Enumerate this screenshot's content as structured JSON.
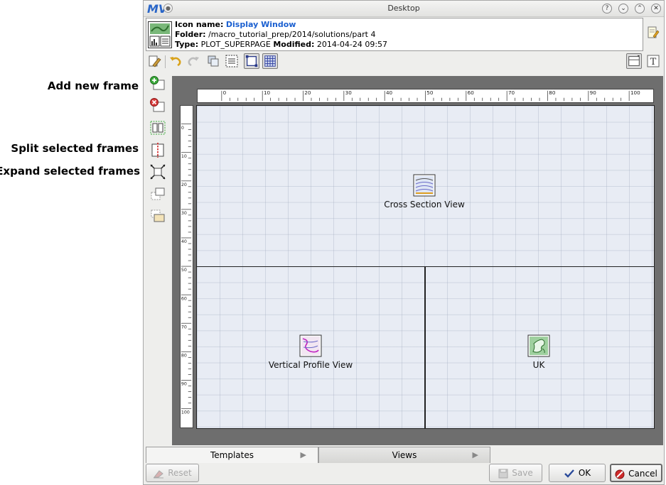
{
  "callouts": {
    "add_new_frame": "Add new frame",
    "split_selected_frames": "Split selected frames",
    "expand_selected_frames": "Expand selected frames"
  },
  "window": {
    "logo": "MV",
    "title": "Desktop",
    "controls": [
      "?",
      "⌄",
      "⌃",
      "✕"
    ]
  },
  "info": {
    "icon_name_label": "Icon name:",
    "icon_name_value": "Display Window",
    "folder_label": "Folder:",
    "folder_value": "/macro_tutorial_prep/2014/solutions/part 4",
    "type_label": "Type:",
    "type_value": "PLOT_SUPERPAGE",
    "modified_label": "Modified:",
    "modified_value": "2014-04-24 09:57"
  },
  "ruler": {
    "h_labels": [
      "0",
      "10",
      "20",
      "30",
      "40",
      "50",
      "60",
      "70",
      "80",
      "90",
      "100"
    ],
    "v_labels": [
      "0",
      "10",
      "20",
      "30",
      "40",
      "50",
      "60",
      "70",
      "80",
      "90",
      "100"
    ]
  },
  "views": {
    "cross_section": "Cross Section View",
    "vertical_profile": "Vertical Profile View",
    "uk": "UK"
  },
  "tabs": {
    "templates": "Templates",
    "views": "Views"
  },
  "buttons": {
    "reset": "Reset",
    "save": "Save",
    "ok": "OK",
    "cancel": "Cancel"
  },
  "colors": {
    "accent_blue": "#1a5fd0",
    "canvas_gray": "#6e6e6e",
    "page_bg": "#e8ecf4"
  }
}
